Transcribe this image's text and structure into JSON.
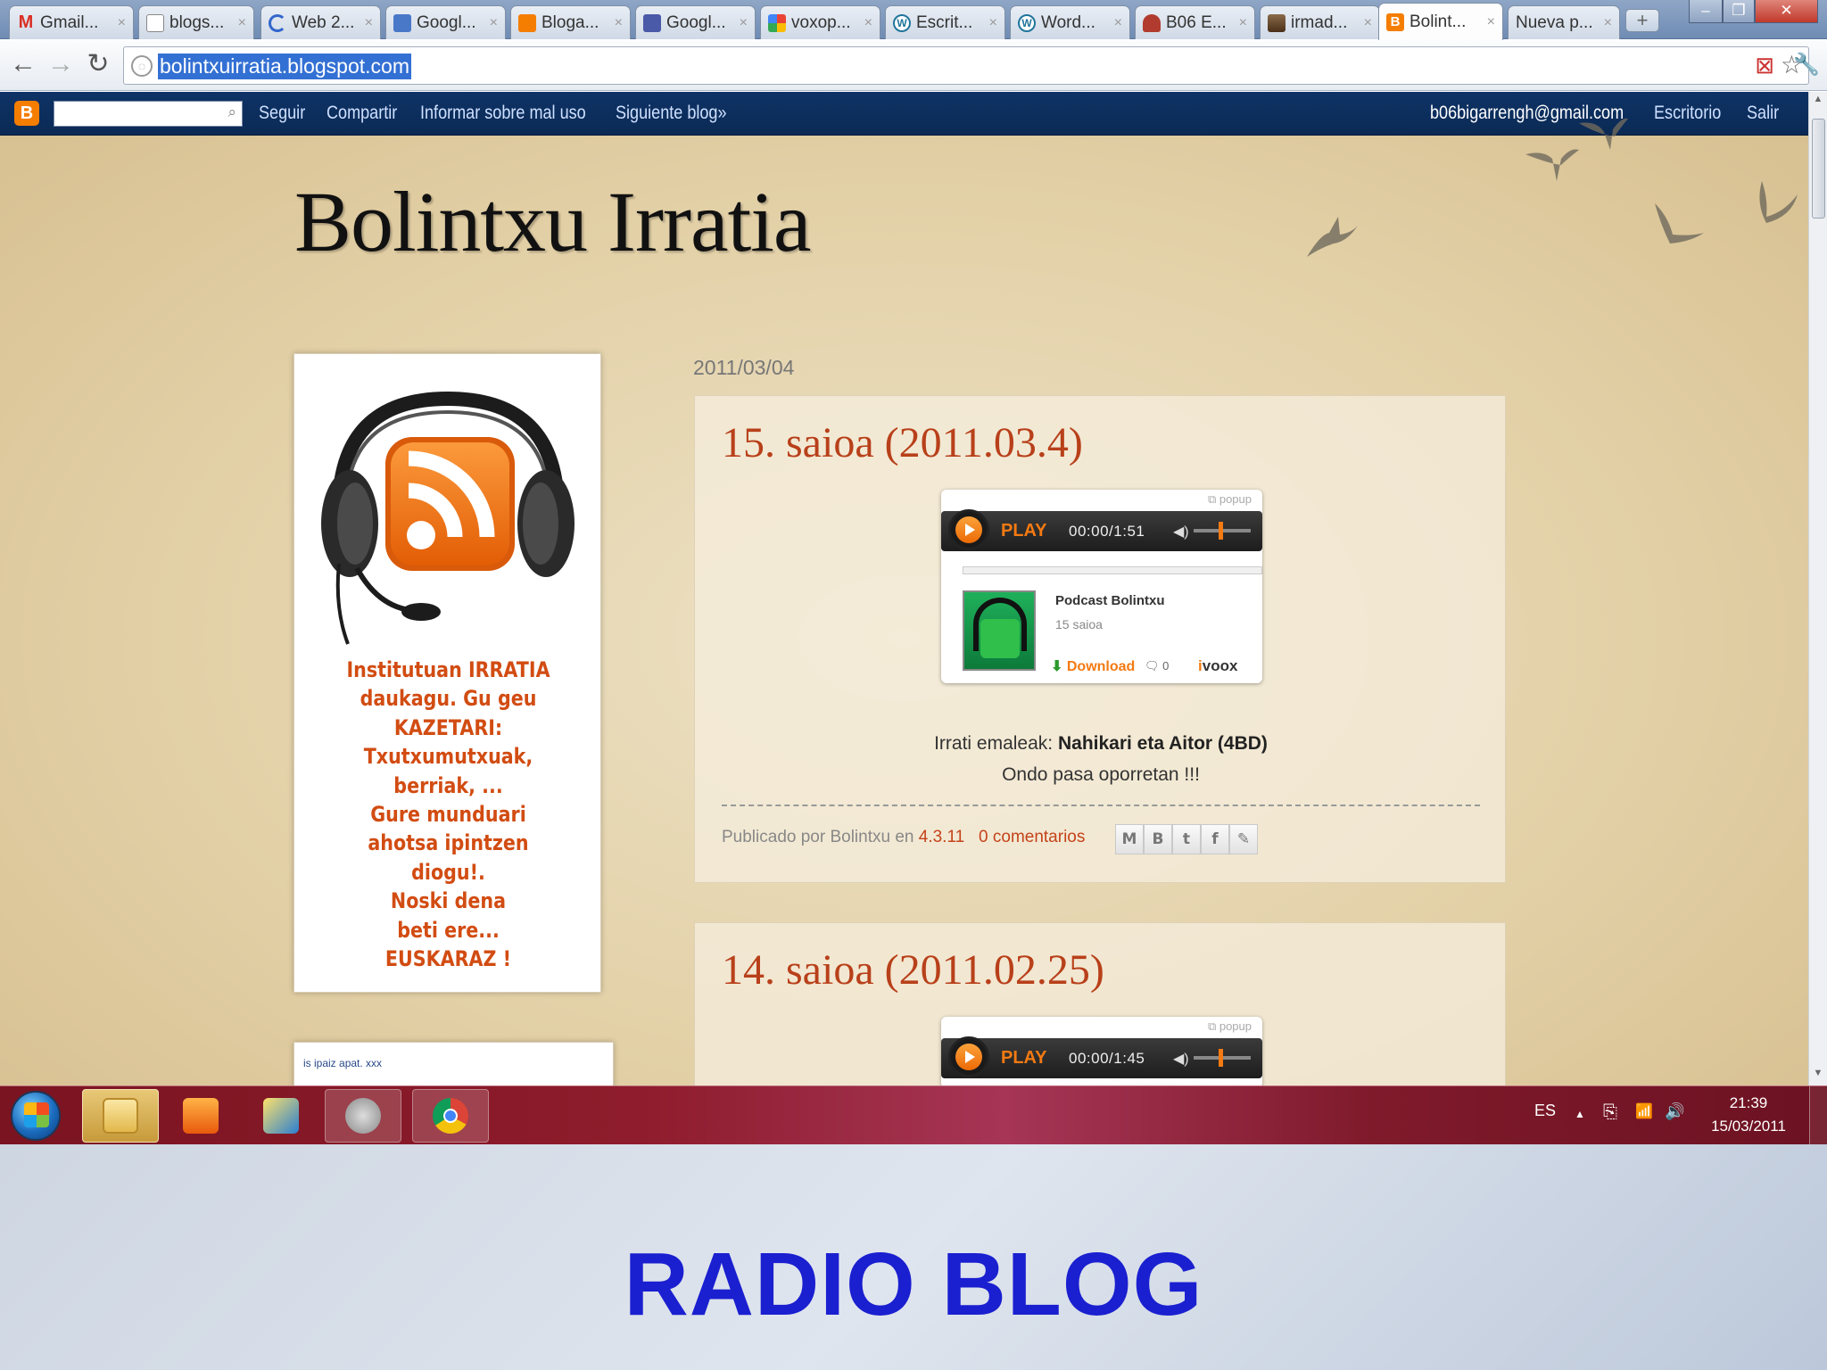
{
  "browser": {
    "tabs": [
      {
        "label": "Gmail...",
        "icon": "gmail-icon",
        "color": "#d93025"
      },
      {
        "label": "blogs...",
        "icon": "page-icon",
        "color": "#777777"
      },
      {
        "label": "Web 2...",
        "icon": "loading-icon",
        "color": "#3366cc"
      },
      {
        "label": "Googl...",
        "icon": "docs-icon",
        "color": "#4a78c8"
      },
      {
        "label": "Bloga...",
        "icon": "blogger-icon",
        "color": "#f57d00"
      },
      {
        "label": "Googl...",
        "icon": "sheet-icon",
        "color": "#4a5aa8"
      },
      {
        "label": "voxop...",
        "icon": "google-icon",
        "color": "#34a853"
      },
      {
        "label": "Escrit...",
        "icon": "wordpress-icon",
        "color": "#21759b"
      },
      {
        "label": "Word...",
        "icon": "wordpress-icon",
        "color": "#21759b"
      },
      {
        "label": "B06 E...",
        "icon": "plant-icon",
        "color": "#b13b2e"
      },
      {
        "label": "irmad...",
        "icon": "image-icon",
        "color": "#6a4a2a"
      },
      {
        "label": "Bolint...",
        "icon": "blogger-icon",
        "color": "#f57d00",
        "active": true
      },
      {
        "label": "Nueva p...",
        "icon": "blank-icon",
        "color": "#999999"
      }
    ],
    "tab_close": "×",
    "new_tab": "+",
    "window_buttons": {
      "minimize": "–",
      "restore": "❐",
      "close": "✕"
    },
    "nav": {
      "back": "←",
      "forward": "→",
      "reload": "↻"
    },
    "url": "bolintxuirratia.blogspot.com",
    "page_action_icons": {
      "blocked": "⊠",
      "star": "☆",
      "wrench": "🔧"
    }
  },
  "navbar": {
    "logo": "B",
    "search_icon": "⌕",
    "links": [
      "Seguir",
      "Compartir",
      "Informar sobre mal uso",
      "Siguiente blog»"
    ],
    "user_email": "b06bigarrengh@gmail.com",
    "desktop_link": "Escritorio",
    "logout_link": "Salir"
  },
  "blog": {
    "title": "Bolintxu Irratia"
  },
  "sidebar": {
    "lines": [
      "Institutuan IRRATIA",
      "daukagu. Gu geu",
      "KAZETARI:",
      "Txutxumutxuak,",
      "berriak, ...",
      "Gure munduari",
      "ahotsa ipintzen",
      "diogu!.",
      "Noski dena",
      "beti ere...",
      "EUSKARAZ !"
    ],
    "second_widget_text": "is ipaiz apat. xxx"
  },
  "posts": {
    "date_header": "2011/03/04",
    "items": [
      {
        "title": "15. saioa (2011.03.4)",
        "player": {
          "popup": "popup",
          "play_label": "PLAY",
          "time": "00:00/1:51",
          "podcast_name": "Podcast Bolintxu",
          "episode": "15 saioa",
          "download": "Download",
          "comments": "0",
          "brand_i": "i",
          "brand": "voox"
        },
        "body_label": "Irrati emaleak:",
        "body_names": "Nahikari eta Aitor (4BD)",
        "body_line2": "Ondo pasa oporretan !!!",
        "meta_prefix": "Publicado por Bolintxu en",
        "meta_time": "4.3.11",
        "meta_comments": "0 comentarios"
      },
      {
        "title": "14. saioa (2011.02.25)",
        "player": {
          "popup": "popup",
          "play_label": "PLAY",
          "time": "00:00/1:45"
        }
      }
    ],
    "share_icons": [
      "M",
      "B",
      "t",
      "f",
      "✎"
    ]
  },
  "taskbar": {
    "apps": [
      "explorer-icon",
      "media-player-icon",
      "paint-icon",
      "camera-icon",
      "chrome-icon"
    ],
    "tray": {
      "language": "ES",
      "arrow": "▲",
      "icons": [
        "⎘",
        "📶",
        "🔊"
      ]
    },
    "time": "21:39",
    "date": "15/03/2011"
  },
  "caption": "RADIO BLOG",
  "colors": {
    "blogger_orange": "#f57d00",
    "post_title": "#b8401a",
    "caption_blue": "#1a1fd0",
    "navbar_blue": "#0e3366"
  }
}
